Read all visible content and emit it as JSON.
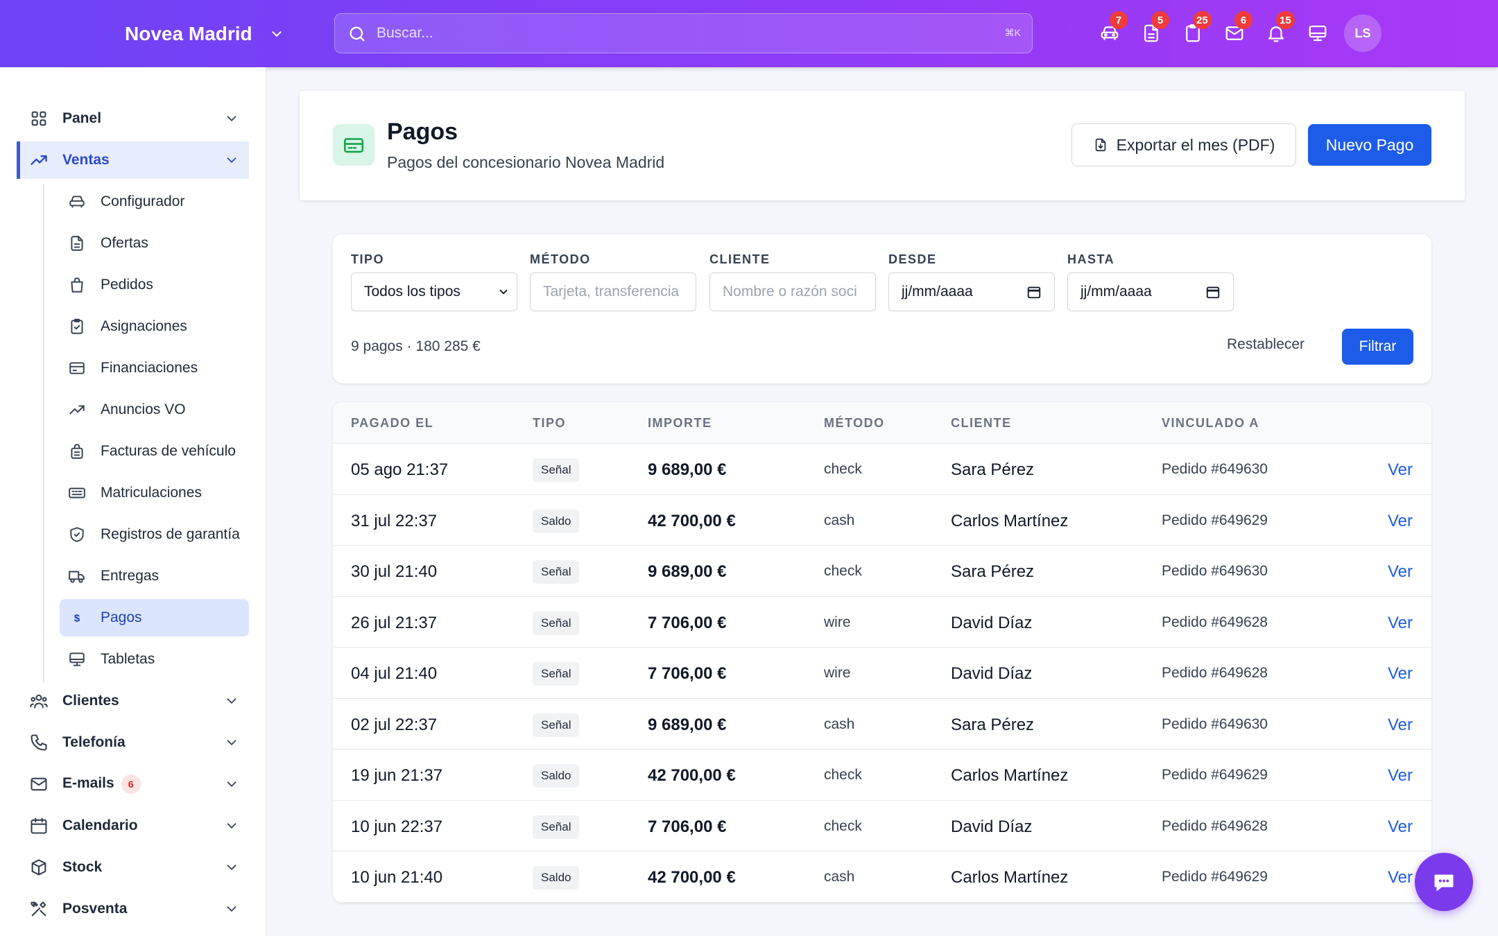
{
  "topbar": {
    "brand": "Novea Madrid",
    "search_placeholder": "Buscar...",
    "search_shortcut": "⌘K",
    "icons": [
      {
        "name": "car-icon",
        "badge": "7"
      },
      {
        "name": "document-icon",
        "badge": "5"
      },
      {
        "name": "clipboard-icon",
        "badge": "25"
      },
      {
        "name": "mail-icon",
        "badge": "6"
      },
      {
        "name": "bell-icon",
        "badge": "15"
      },
      {
        "name": "monitor-icon",
        "badge": ""
      }
    ],
    "avatar_initials": "LS"
  },
  "sidebar": {
    "items": [
      {
        "label": "Panel"
      },
      {
        "label": "Ventas"
      },
      {
        "label": "Clientes"
      },
      {
        "label": "Telefonía"
      },
      {
        "label": "E-mails",
        "badge": "6"
      },
      {
        "label": "Calendario"
      },
      {
        "label": "Stock"
      },
      {
        "label": "Posventa"
      }
    ],
    "sub_items": [
      {
        "label": "Configurador"
      },
      {
        "label": "Ofertas"
      },
      {
        "label": "Pedidos"
      },
      {
        "label": "Asignaciones"
      },
      {
        "label": "Financiaciones"
      },
      {
        "label": "Anuncios VO"
      },
      {
        "label": "Facturas de vehículo"
      },
      {
        "label": "Matriculaciones"
      },
      {
        "label": "Registros de garantía"
      },
      {
        "label": "Entregas"
      },
      {
        "label": "Pagos"
      },
      {
        "label": "Tabletas"
      }
    ]
  },
  "header": {
    "title": "Pagos",
    "subtitle": "Pagos del concesionario Novea Madrid",
    "export_label": "Exportar el mes (PDF)",
    "new_label": "Nuevo Pago"
  },
  "filters": {
    "tipo_label": "TIPO",
    "tipo_value": "Todos los tipos",
    "metodo_label": "MÉTODO",
    "metodo_placeholder": "Tarjeta, transferencia",
    "cliente_label": "CLIENTE",
    "cliente_placeholder": "Nombre o razón soci",
    "desde_label": "DESDE",
    "desde_value": "jj/mm/aaaa",
    "hasta_label": "HASTA",
    "hasta_value": "jj/mm/aaaa",
    "summary": "9 pagos · 180 285 €",
    "reset_label": "Restablecer",
    "filter_label": "Filtrar"
  },
  "table": {
    "columns": [
      "PAGADO EL",
      "TIPO",
      "IMPORTE",
      "MÉTODO",
      "CLIENTE",
      "VINCULADO A"
    ],
    "action_label": "Ver",
    "rows": [
      {
        "date": "05 ago 21:37",
        "tipo": "Señal",
        "importe": "9 689,00 €",
        "metodo": "check",
        "cliente": "Sara Pérez",
        "vinculado": "Pedido #649630"
      },
      {
        "date": "31 jul 22:37",
        "tipo": "Saldo",
        "importe": "42 700,00 €",
        "metodo": "cash",
        "cliente": "Carlos Martínez",
        "vinculado": "Pedido #649629"
      },
      {
        "date": "30 jul 21:40",
        "tipo": "Señal",
        "importe": "9 689,00 €",
        "metodo": "check",
        "cliente": "Sara Pérez",
        "vinculado": "Pedido #649630"
      },
      {
        "date": "26 jul 21:37",
        "tipo": "Señal",
        "importe": "7 706,00 €",
        "metodo": "wire",
        "cliente": "David Díaz",
        "vinculado": "Pedido #649628"
      },
      {
        "date": "04 jul 21:40",
        "tipo": "Señal",
        "importe": "7 706,00 €",
        "metodo": "wire",
        "cliente": "David Díaz",
        "vinculado": "Pedido #649628"
      },
      {
        "date": "02 jul 22:37",
        "tipo": "Señal",
        "importe": "9 689,00 €",
        "metodo": "cash",
        "cliente": "Sara Pérez",
        "vinculado": "Pedido #649630"
      },
      {
        "date": "19 jun 21:37",
        "tipo": "Saldo",
        "importe": "42 700,00 €",
        "metodo": "check",
        "cliente": "Carlos Martínez",
        "vinculado": "Pedido #649629"
      },
      {
        "date": "10 jun 22:37",
        "tipo": "Señal",
        "importe": "7 706,00 €",
        "metodo": "check",
        "cliente": "David Díaz",
        "vinculado": "Pedido #649628"
      },
      {
        "date": "10 jun 21:40",
        "tipo": "Saldo",
        "importe": "42 700,00 €",
        "metodo": "cash",
        "cliente": "Carlos Martínez",
        "vinculado": "Pedido #649629"
      }
    ]
  },
  "colors": {
    "primary": "#1d5ce8",
    "accent_purple": "#7c3aed",
    "badge_red": "#ef3b3b"
  }
}
